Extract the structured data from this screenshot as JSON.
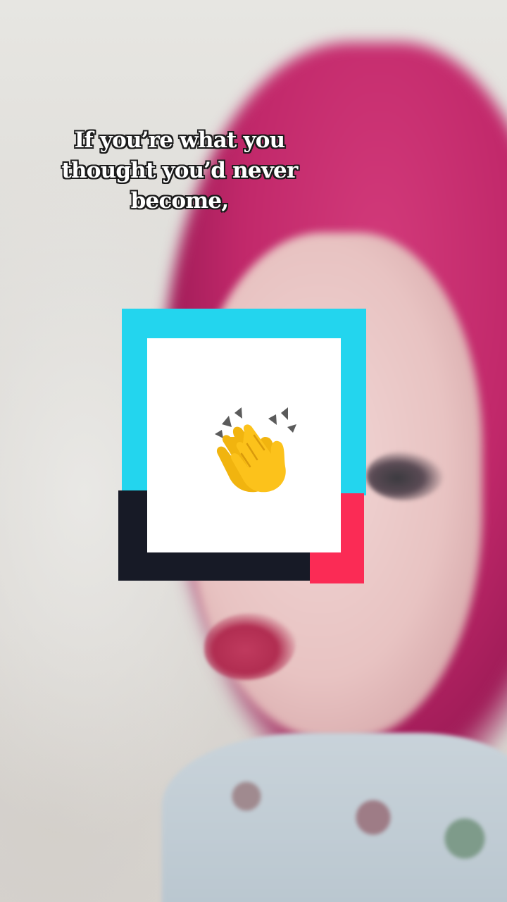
{
  "caption": {
    "lines": [
      "If you’re what you",
      "thought you’d never",
      "become,"
    ]
  },
  "sticker": {
    "icon": "clapping-hands-icon",
    "colors": {
      "cyan": "#23d5ee",
      "dark": "#171a26",
      "red": "#fb2b55",
      "card": "#ffffff"
    }
  }
}
